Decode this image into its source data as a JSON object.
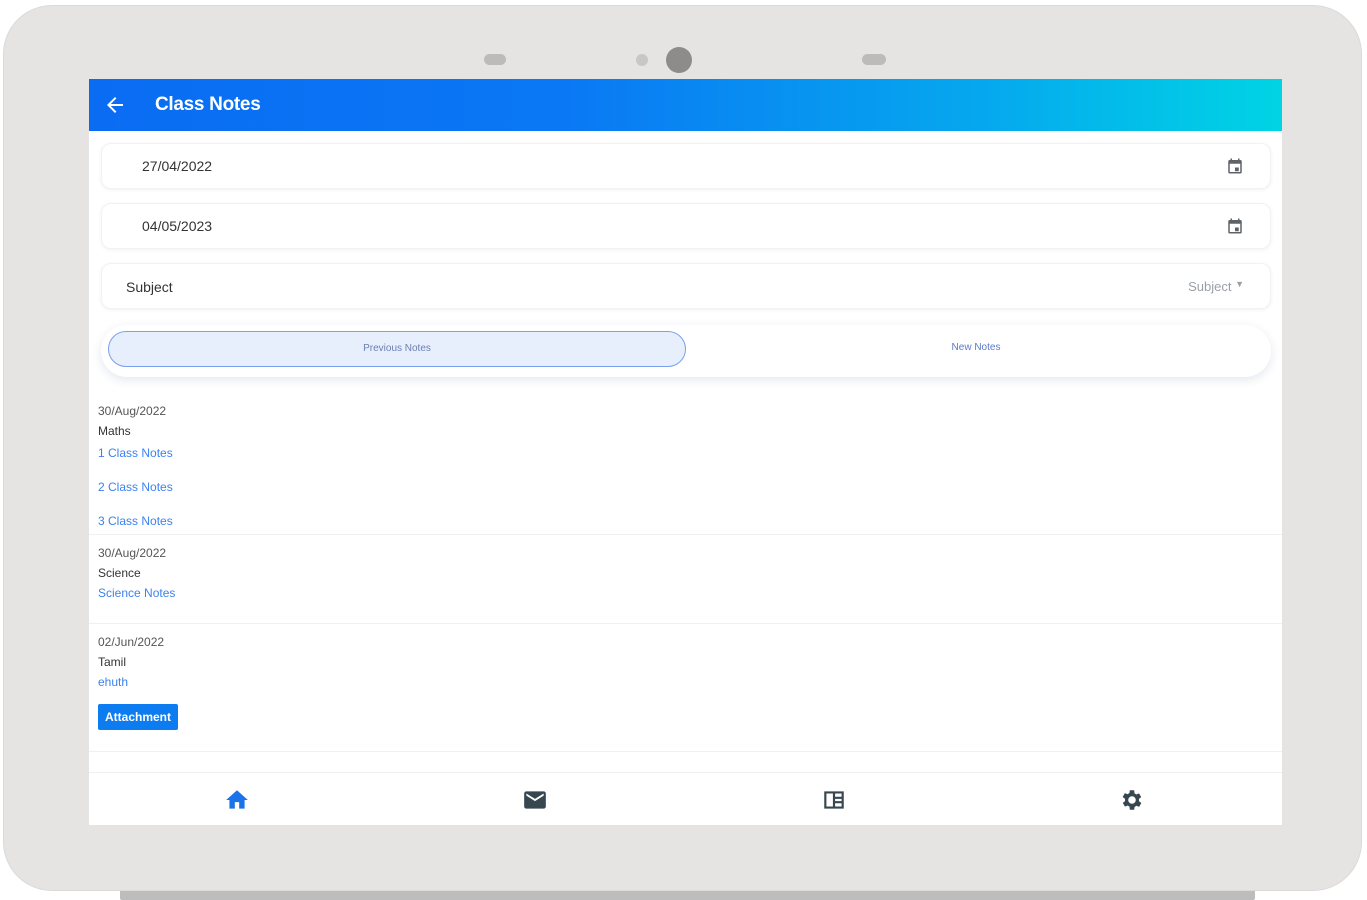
{
  "header": {
    "title": "Class Notes",
    "back_icon": "arrow-left-icon"
  },
  "filters": {
    "from_date": "27/04/2022",
    "to_date": "04/05/2023",
    "subject_label": "Subject",
    "subject_select": "Subject",
    "calendar_icon": "calendar-icon"
  },
  "toggle": {
    "previous_label": "Previous Notes",
    "new_label": "New Notes"
  },
  "notes": [
    {
      "date": "30/Aug/2022",
      "subject": "Maths",
      "links": [
        "1 Class Notes",
        "2 Class Notes",
        "3 Class Notes"
      ]
    },
    {
      "date": "30/Aug/2022",
      "subject": "Science",
      "links": [
        "Science Notes"
      ]
    },
    {
      "date": "02/Jun/2022",
      "subject": "Tamil",
      "links": [
        "ehuth"
      ],
      "attachment_label": "Attachment"
    }
  ],
  "bottom_nav": [
    {
      "icon": "home-icon",
      "active": true
    },
    {
      "icon": "mail-icon",
      "active": false
    },
    {
      "icon": "news-icon",
      "active": false
    },
    {
      "icon": "gear-icon",
      "active": false
    }
  ],
  "colors": {
    "accent": "#0a6cf3",
    "gradient_end": "#00d4e4",
    "link": "#3b82f0",
    "nav_active": "#1a73e8",
    "nav_inactive": "#37474f"
  }
}
